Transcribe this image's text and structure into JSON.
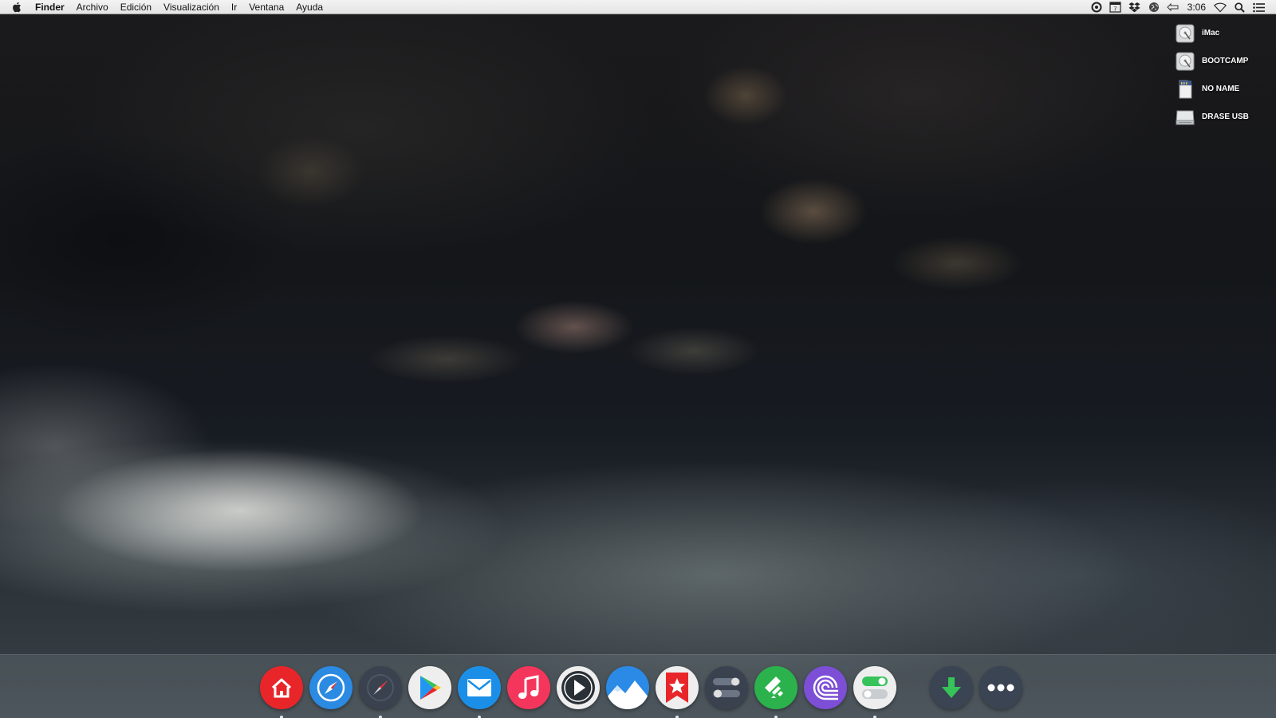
{
  "menubar": {
    "apple_icon": "apple-logo-icon",
    "app_name": "Finder",
    "menus": [
      "Archivo",
      "Edición",
      "Visualización",
      "Ir",
      "Ventana",
      "Ayuda"
    ],
    "status_icons": [
      "screen-record-icon",
      "calendar-icon",
      "dropbox-icon",
      "globe-icon",
      "battery-icon"
    ],
    "calendar_day": "7",
    "clock": "3:06",
    "right_icons": [
      "wifi-icon",
      "spotlight-search-icon",
      "notification-center-icon"
    ]
  },
  "desktop": {
    "volumes": [
      {
        "label": "iMac",
        "icon": "hard-disk-icon"
      },
      {
        "label": "BOOTCAMP",
        "icon": "hard-disk-icon"
      },
      {
        "label": "NO NAME",
        "icon": "sd-card-icon"
      },
      {
        "label": "DRASE USB",
        "icon": "usb-drive-icon"
      }
    ]
  },
  "dock": {
    "apps": [
      {
        "icon": "home-icon",
        "color": "#e8262a",
        "running": true
      },
      {
        "icon": "safari-compass-icon",
        "color": "#2b8ae2",
        "running": false
      },
      {
        "icon": "compass-dark-icon",
        "color": "#3a4250",
        "running": true
      },
      {
        "icon": "play-store-icon",
        "color": "#eeeeee",
        "running": false
      },
      {
        "icon": "mail-icon",
        "color": "#1b8fe8",
        "running": true
      },
      {
        "icon": "music-icon",
        "color": "#f5365c",
        "running": false
      },
      {
        "icon": "play-circle-icon",
        "color": "#eeeeee",
        "running": false
      },
      {
        "icon": "photos-mountain-icon",
        "color": "#2a8ae6",
        "running": false
      },
      {
        "icon": "star-bookmark-icon",
        "color": "#e8262a",
        "running": true
      },
      {
        "icon": "toggles-icon",
        "color": "#3a4250",
        "running": false
      },
      {
        "icon": "feedly-icon",
        "color": "#2bb24c",
        "running": true
      },
      {
        "icon": "bittorrent-icon",
        "color": "#7c4fd6",
        "running": false
      },
      {
        "icon": "switch-settings-icon",
        "color": "#eeeeee",
        "running": true
      },
      {
        "icon": "download-arrow-icon",
        "color": "#3a4452",
        "running": false
      },
      {
        "icon": "more-dots-icon",
        "color": "#3a4452",
        "running": false
      }
    ]
  }
}
